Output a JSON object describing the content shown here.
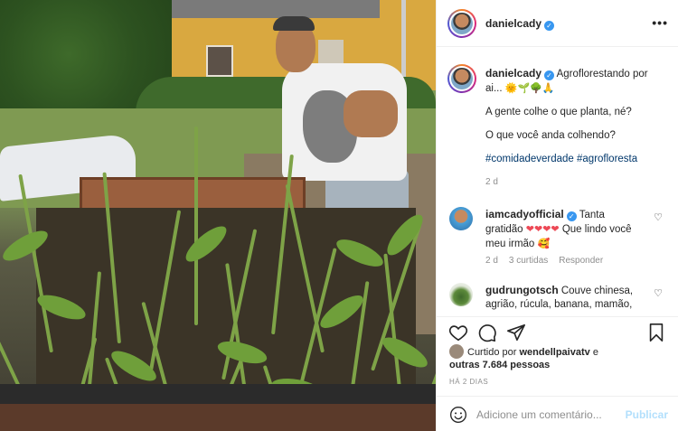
{
  "post": {
    "author": "danielcady",
    "verified": true,
    "more_label": "•••"
  },
  "caption": {
    "author": "danielcady",
    "line1": "Agroflorestando por ai...",
    "emojis": "🌞🌱🌳🙏",
    "line2": "A gente colhe o que planta, né?",
    "line3": "O que você anda colhendo?",
    "hashtags": "#comidadeverdade #agrofloresta",
    "time": "2 d"
  },
  "comments": [
    {
      "user": "iamcadyofficial",
      "verified": true,
      "text_before": "Tanta gratidão",
      "hearts": "❤❤❤❤",
      "text_after": "Que lindo você meu irmão",
      "emoji_end": "🥰",
      "time": "2 d",
      "likes": "3 curtidas",
      "reply": "Responder"
    },
    {
      "user": "gudrungotsch",
      "verified": false,
      "text": "Couve chinesa, agrião, rúcula, banana, mamão,"
    }
  ],
  "likes": {
    "prefix": "Curtido por",
    "user": "wendellpaivatv",
    "connector": "e",
    "others": "outras 7.684 pessoas"
  },
  "timeago": "HÁ 2 DIAS",
  "add_comment": {
    "placeholder": "Adicione um comentário...",
    "post_label": "Publicar"
  },
  "colors": {
    "verified": "#3897f0",
    "hashtag": "#00376b",
    "heart": "#ed4956",
    "post_disabled": "#b2dffc",
    "muted": "#8e8e8e"
  }
}
